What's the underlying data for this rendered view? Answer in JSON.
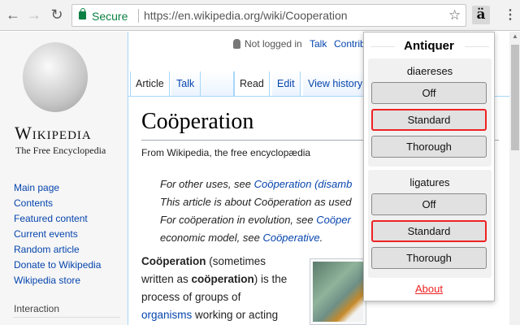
{
  "browser": {
    "secure_label": "Secure",
    "url": "https://en.wikipedia.org/wiki/Cooperation",
    "extension_icon_glyph": "ä"
  },
  "wiki": {
    "wordmark": "Wikipedia",
    "tagline": "The Free Encyclopedia",
    "nav": [
      "Main page",
      "Contents",
      "Featured content",
      "Current events",
      "Random article",
      "Donate to Wikipedia",
      "Wikipedia store"
    ],
    "interaction_heading": "Interaction",
    "personal": {
      "not_logged_in": "Not logged in",
      "talk": "Talk",
      "contrib": "Contrib"
    },
    "tabs": {
      "article": "Article",
      "talk": "Talk",
      "read": "Read",
      "edit": "Edit",
      "history": "View history"
    },
    "title": "Coöperation",
    "from": "From Wikipedia, the free encyclopædia",
    "hatnotes": [
      {
        "pre": "For other uses, see ",
        "link": "Coöperation (disamb",
        "post": ""
      },
      {
        "pre": "This article is about Coöperation as used",
        "link": "",
        "post": ""
      },
      {
        "pre": "For coöperation in evolution, see ",
        "link": "Coöper",
        "post": ""
      },
      {
        "pre": "economic model, see ",
        "link": "Coöperative",
        "post": "."
      }
    ],
    "body": {
      "b1": "Coöperation",
      "t1": " (sometimes",
      "t2": "written as ",
      "b2": "coöperation",
      "t3": ") is the",
      "t4": "process of groups of",
      "link": "organisms",
      "t5": " working or acting"
    }
  },
  "popup": {
    "title": "Antiquer",
    "groups": [
      {
        "label": "diaereses",
        "options": [
          "Off",
          "Standard",
          "Thorough"
        ],
        "selected": "Standard"
      },
      {
        "label": "ligatures",
        "options": [
          "Off",
          "Standard",
          "Thorough"
        ],
        "selected": "Standard"
      }
    ],
    "about": "About",
    "accent_color": "#e22222"
  }
}
